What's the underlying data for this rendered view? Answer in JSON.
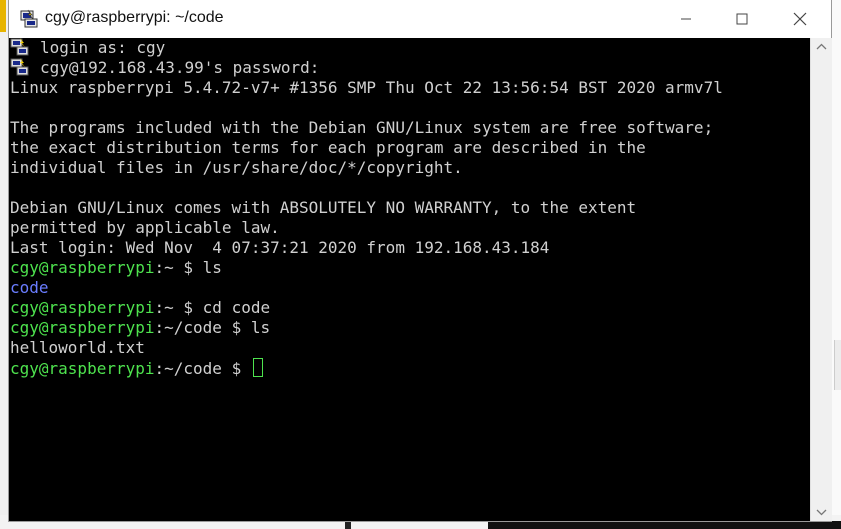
{
  "window": {
    "title": "cgy@raspberrypi: ~/code",
    "app_icon": "putty-icon",
    "controls": [
      "minimize-icon",
      "maximize-icon",
      "close-icon"
    ]
  },
  "terminal": {
    "login_line": "login as: cgy",
    "password_line": "cgy@192.168.43.99's password:",
    "lines": [
      "Linux raspberrypi 5.4.72-v7+ #1356 SMP Thu Oct 22 13:56:54 BST 2020 armv7l",
      "",
      "The programs included with the Debian GNU/Linux system are free software;",
      "the exact distribution terms for each program are described in the",
      "individual files in /usr/share/doc/*/copyright.",
      "",
      "Debian GNU/Linux comes with ABSOLUTELY NO WARRANTY, to the extent",
      "permitted by applicable law.",
      "Last login: Wed Nov  4 07:37:21 2020 from 192.168.43.184"
    ],
    "prompt_user": "cgy@raspberrypi",
    "commands": [
      {
        "path": ":~",
        "dollar": " $ ",
        "cmd": "ls"
      },
      {
        "output": "code"
      },
      {
        "path": ":~",
        "dollar": " $ ",
        "cmd": "cd code"
      },
      {
        "path": ":~/code",
        "dollar": " $ ",
        "cmd": "ls"
      },
      {
        "output": "helloworld.txt"
      },
      {
        "path": ":~/code",
        "dollar": " $ ",
        "cmd": ""
      }
    ],
    "colors": {
      "background": "#000000",
      "text": "#d0d0d0",
      "prompt": "#4ee34e",
      "directory": "#6a7dff"
    }
  }
}
